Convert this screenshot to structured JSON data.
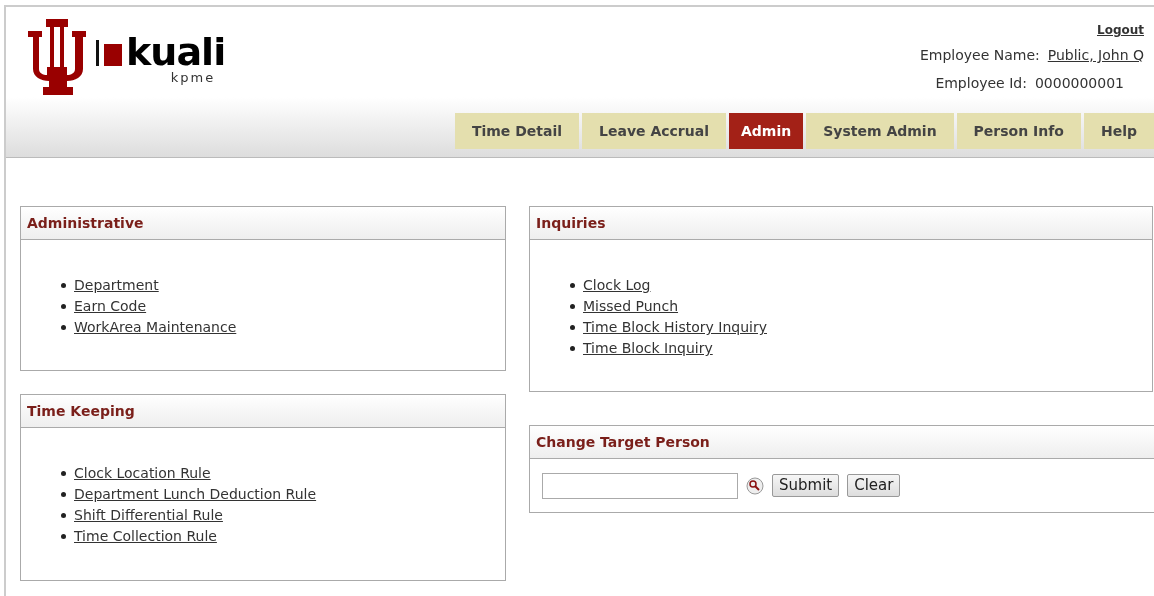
{
  "logo": {
    "wordmark": "kuali",
    "product": "kpme"
  },
  "header": {
    "logout": "Logout",
    "employee_name_label": "Employee Name:",
    "employee_name": "Public, John Q",
    "employee_id_label": "Employee Id:",
    "employee_id": "0000000001"
  },
  "tabs": [
    {
      "label": "Time Detail",
      "selected": false
    },
    {
      "label": "Leave Accrual",
      "selected": false
    },
    {
      "label": "Admin",
      "selected": true
    },
    {
      "label": "System Admin",
      "selected": false
    },
    {
      "label": "Person Info",
      "selected": false
    },
    {
      "label": "Help",
      "selected": false
    }
  ],
  "left_panels": [
    {
      "title": "Administrative",
      "links": [
        "Department",
        "Earn Code",
        "WorkArea Maintenance"
      ]
    },
    {
      "title": "Time Keeping",
      "links": [
        "Clock Location Rule",
        "Department Lunch Deduction Rule",
        "Shift Differential Rule",
        "Time Collection Rule"
      ]
    }
  ],
  "inquiries": {
    "title": "Inquiries",
    "links": [
      "Clock Log",
      "Missed Punch",
      "Time Block History Inquiry",
      "Time Block Inquiry"
    ]
  },
  "change_target": {
    "title": "Change Target Person",
    "buttons": [
      "Submit",
      "Clear"
    ]
  }
}
